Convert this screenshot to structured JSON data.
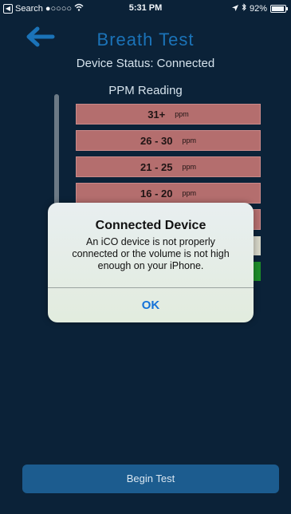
{
  "status_bar": {
    "back_app": "Search",
    "signal": "●○○○○",
    "time": "5:31 PM",
    "battery": "92%",
    "battery_level": 0.92
  },
  "header": {
    "title": "Breath Test"
  },
  "device_status": "Device Status: Connected",
  "ppm_title": "PPM Reading",
  "ppm_rows": [
    {
      "range": "31+",
      "unit": "ppm"
    },
    {
      "range": "26 - 30",
      "unit": "ppm"
    },
    {
      "range": "21 - 25",
      "unit": "ppm"
    },
    {
      "range": "16 - 20",
      "unit": "ppm"
    }
  ],
  "alert": {
    "title": "Connected Device",
    "message": "An iCO device is not properly connected or the volume is not high enough on your iPhone.",
    "ok_label": "OK"
  },
  "begin_button": "Begin Test",
  "colors": {
    "background": "#0b2238",
    "accent": "#1b73b8",
    "ppm_high": "#b46e6e",
    "ppm_ok": "#1e8c2a"
  }
}
